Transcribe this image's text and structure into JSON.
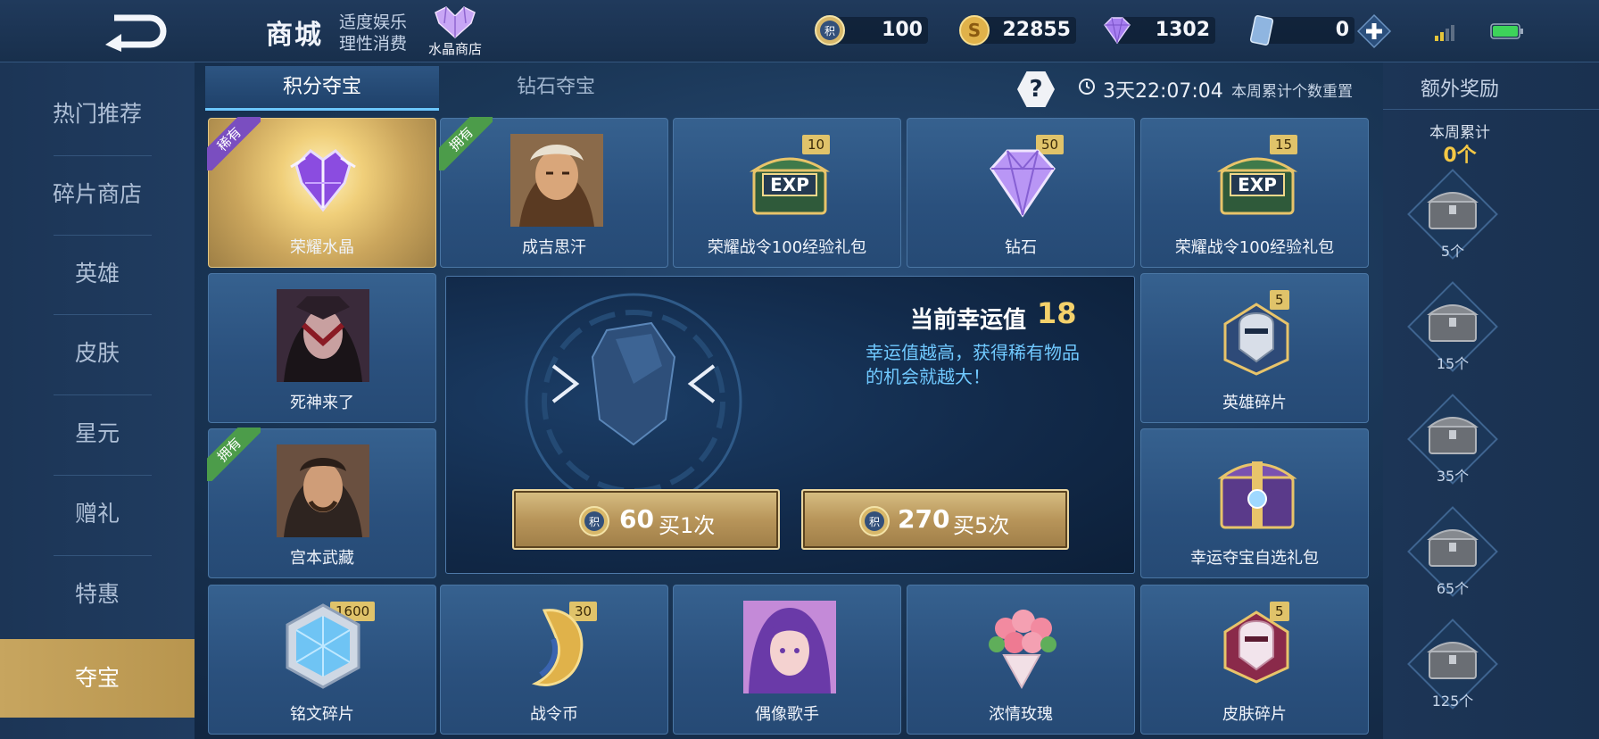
{
  "header": {
    "title": "商城",
    "subtitle_line1": "适度娱乐",
    "subtitle_line2": "理性消费",
    "crystal_shop_label": "水晶商店"
  },
  "currencies": [
    {
      "name": "points",
      "value": "100"
    },
    {
      "name": "gold",
      "value": "22855"
    },
    {
      "name": "diamond",
      "value": "1302"
    },
    {
      "name": "coupon",
      "value": "0"
    }
  ],
  "sidebar": {
    "items": [
      {
        "label": "热门推荐"
      },
      {
        "label": "碎片商店"
      },
      {
        "label": "英雄"
      },
      {
        "label": "皮肤"
      },
      {
        "label": "星元"
      },
      {
        "label": "赠礼"
      },
      {
        "label": "特惠"
      },
      {
        "label": "夺宝"
      }
    ]
  },
  "tabs": {
    "points": "积分夺宝",
    "diamond": "钻石夺宝"
  },
  "help_label": "?",
  "timer": {
    "value": "3天22:07:04",
    "note": "本周累计个数重置"
  },
  "cards": [
    {
      "name": "荣耀水晶",
      "badge": "稀有"
    },
    {
      "name": "成吉思汗",
      "badge": "拥有"
    },
    {
      "name": "荣耀战令100经验礼包",
      "qty": "10"
    },
    {
      "name": "钻石",
      "qty": "50"
    },
    {
      "name": "荣耀战令100经验礼包",
      "qty": "15"
    },
    {
      "name": "死神来了"
    },
    {
      "name": "英雄碎片",
      "qty": "5"
    },
    {
      "name": "宫本武藏",
      "badge": "拥有"
    },
    {
      "name": "幸运夺宝自选礼包"
    },
    {
      "name": "铭文碎片",
      "qty": "1600"
    },
    {
      "name": "战令币",
      "qty": "30"
    },
    {
      "name": "偶像歌手"
    },
    {
      "name": "浓情玫瑰"
    },
    {
      "name": "皮肤碎片",
      "qty": "5"
    }
  ],
  "lucky": {
    "title": "当前幸运值",
    "value": "18",
    "desc": "幸运值越高，获得稀有物品的机会就越大！",
    "buy1_num": "60",
    "buy1_text": "买1次",
    "buy5_num": "270",
    "buy5_text": "买5次"
  },
  "extra": {
    "title": "额外奖励",
    "week_label": "本周累计",
    "week_value": "0个",
    "milestones": [
      "5个",
      "15个",
      "35个",
      "65个",
      "125个"
    ]
  },
  "colors": {
    "accent_gold": "#f4c845",
    "accent_blue": "#70c9ff",
    "card_blue": "#2a507d",
    "active_gold": "#c7a55f"
  }
}
